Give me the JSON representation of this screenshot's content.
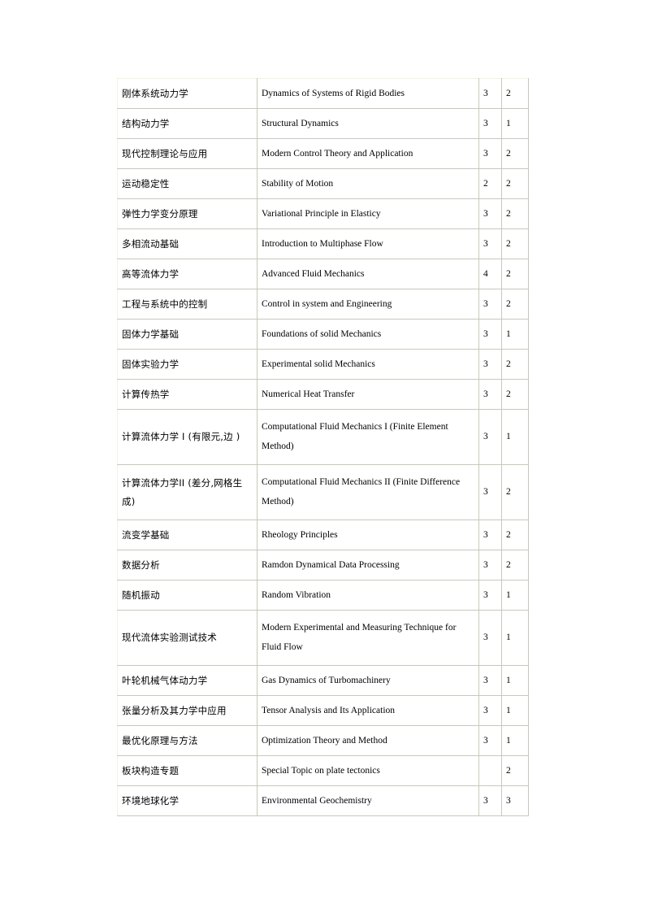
{
  "document": {
    "page_background": "#ffffff",
    "table_border_color": "#9b9b9b",
    "cell_border_color": "#c8c8bd",
    "columns": [
      "course_name_cn",
      "course_name_en",
      "credits",
      "term"
    ]
  },
  "table_rows": [
    {
      "cn": "刚体系统动力学",
      "en": "Dynamics of Systems of Rigid Bodies",
      "credits": "3",
      "term": "2",
      "multiline": false
    },
    {
      "cn": "结构动力学",
      "en": "Structural Dynamics",
      "credits": "3",
      "term": "1",
      "multiline": false
    },
    {
      "cn": "现代控制理论与应用",
      "en": "Modern Control Theory and Application",
      "credits": "3",
      "term": "2",
      "multiline": false
    },
    {
      "cn": "运动稳定性",
      "en": "Stability of Motion",
      "credits": "2",
      "term": "2",
      "multiline": false
    },
    {
      "cn": "弹性力学变分原理",
      "en": "Variational Principle in Elasticy",
      "credits": "3",
      "term": "2",
      "multiline": false
    },
    {
      "cn": "多相流动基础",
      "en": "Introduction to Multiphase Flow",
      "credits": "3",
      "term": "2",
      "multiline": false
    },
    {
      "cn": "高等流体力学",
      "en": "Advanced Fluid Mechanics",
      "credits": "4",
      "term": "2",
      "multiline": false
    },
    {
      "cn": "工程与系统中的控制",
      "en": "Control in system and Engineering",
      "credits": "3",
      "term": "2",
      "multiline": false
    },
    {
      "cn": "固体力学基础",
      "en": "Foundations of solid Mechanics",
      "credits": "3",
      "term": "1",
      "multiline": false
    },
    {
      "cn": "固体实验力学",
      "en": "Experimental  solid Mechanics",
      "credits": "3",
      "term": "2",
      "multiline": false
    },
    {
      "cn": "计算传热学",
      "en": "Numerical Heat Transfer",
      "credits": "3",
      "term": "2",
      "multiline": false
    },
    {
      "cn": "计算流体力学 I (有限元,边 )",
      "en": "Computational Fluid Mechanics  I (Finite Element Method)",
      "en_line1": "Computational Fluid Mechanics  I (Finite Element",
      "en_line2": "Method)",
      "credits": "3",
      "term": "1",
      "multiline": true
    },
    {
      "cn": "计算流体力学II (差分,网格生成)",
      "en": "Computational Fluid Mechanics II (Finite Difference Method)",
      "en_line1": "Computational Fluid Mechanics II (Finite Difference",
      "en_line2": "Method)",
      "credits": "3",
      "term": "2",
      "multiline": true
    },
    {
      "cn": "流变学基础",
      "en": "Rheology Principles",
      "credits": "3",
      "term": "2",
      "multiline": false
    },
    {
      "cn": "数据分析",
      "en": "Ramdon Dynamical Data Processing",
      "credits": "3",
      "term": "2",
      "multiline": false
    },
    {
      "cn": "随机振动",
      "en": "Random Vibration",
      "credits": "3",
      "term": "1",
      "multiline": false
    },
    {
      "cn": "现代流体实验测试技术",
      "en": "Modern Experimental  and Measuring Technique  for Fluid Flow",
      "en_line1": "Modern Experimental  and Measuring Technique  for",
      "en_line2": "Fluid Flow",
      "credits": "3",
      "term": "1",
      "multiline": true
    },
    {
      "cn": "叶轮机械气体动力学",
      "en": "Gas Dynamics of Turbomachinery",
      "credits": "3",
      "term": "1",
      "multiline": false
    },
    {
      "cn": "张量分析及其力学中应用",
      "en": "Tensor Analysis and Its Application",
      "credits": "3",
      "term": "1",
      "multiline": false
    },
    {
      "cn": "最优化原理与方法",
      "en": "Optimization  Theory and Method",
      "credits": "3",
      "term": "1",
      "multiline": false
    },
    {
      "cn": "板块构造专题",
      "en": "Special Topic on plate  tectonics",
      "credits": "",
      "term": "2",
      "multiline": false
    },
    {
      "cn": "环境地球化学",
      "en": "Environmental  Geochemistry",
      "credits": "3",
      "term": "3",
      "multiline": false
    }
  ]
}
